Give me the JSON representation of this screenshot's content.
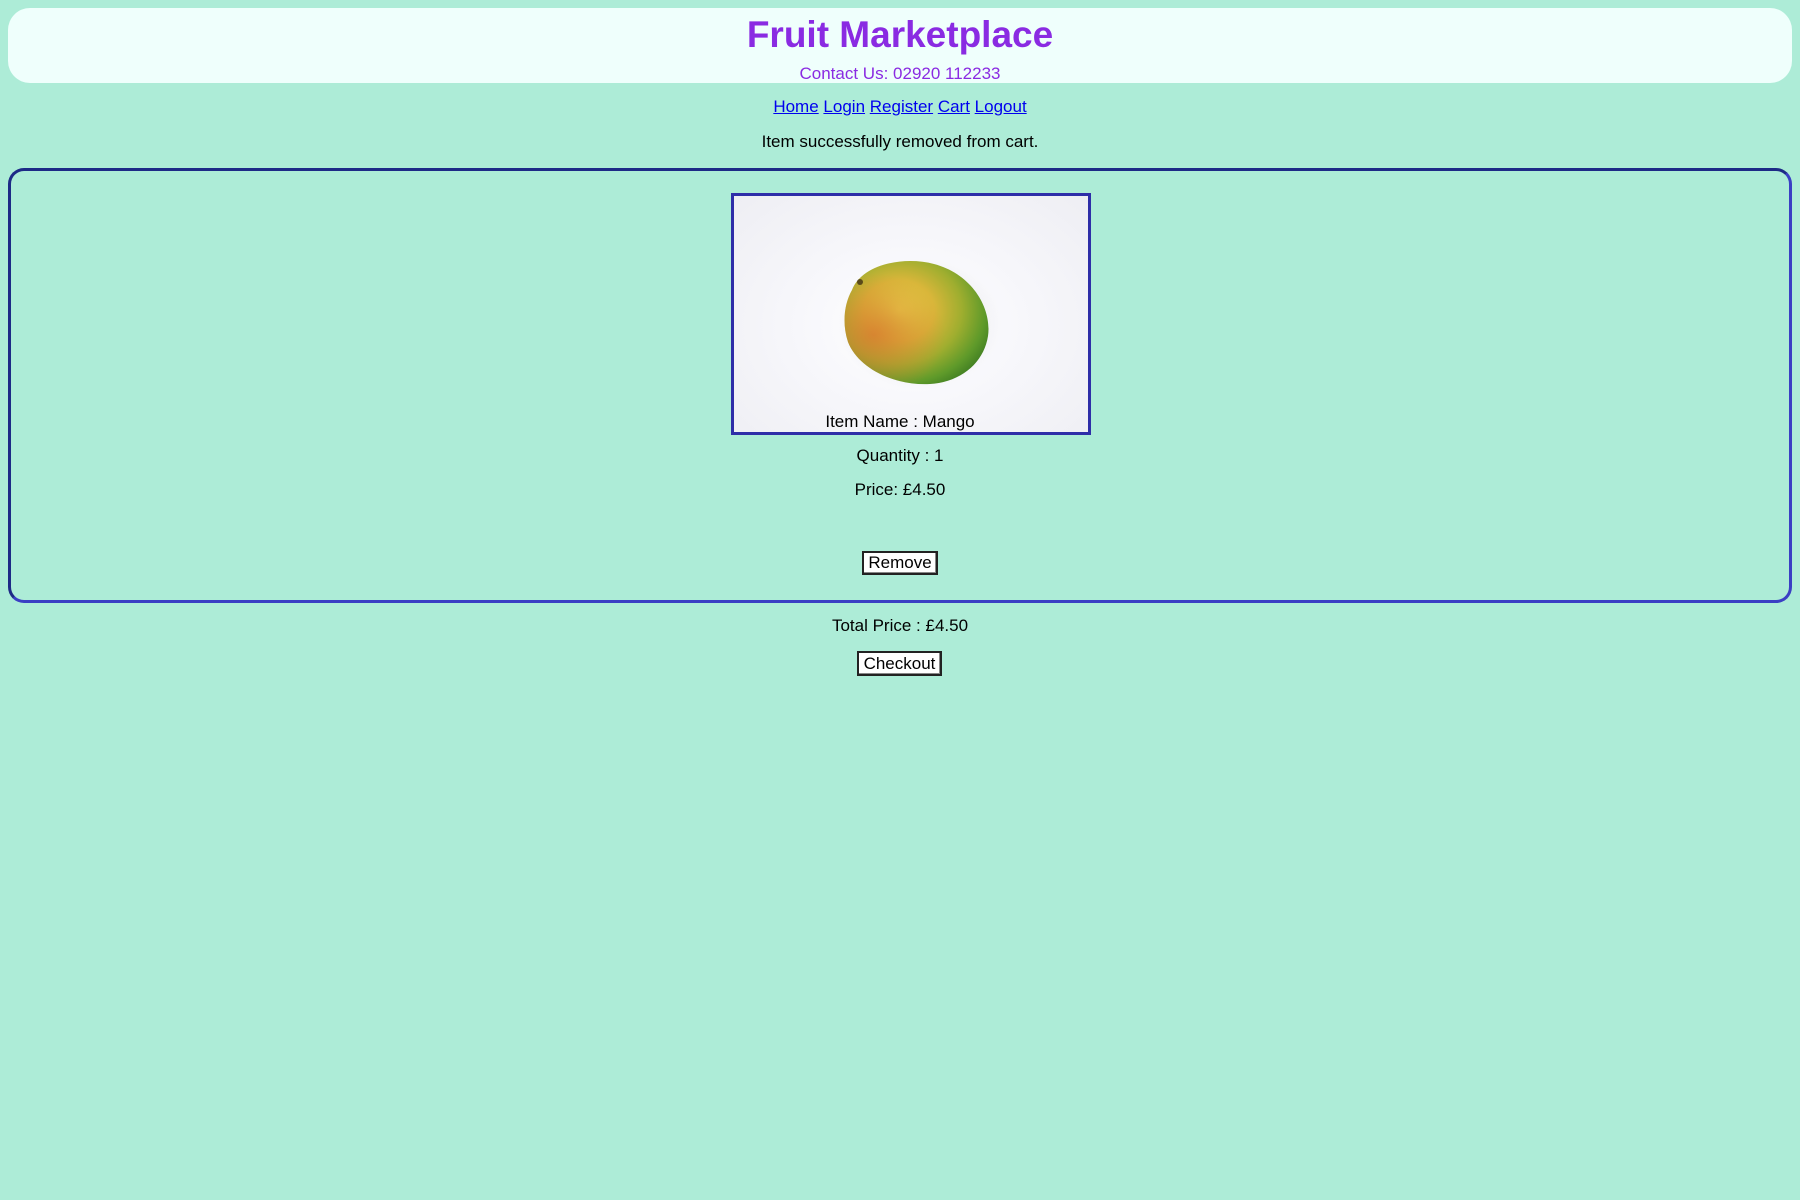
{
  "header": {
    "title": "Fruit Marketplace",
    "contact": "Contact Us: 02920 112233"
  },
  "nav": {
    "items": [
      "Home",
      "Login",
      "Register",
      "Cart",
      "Logout"
    ]
  },
  "status_message": "Item successfully removed from cart.",
  "cart": {
    "items": [
      {
        "image_icon": "mango-image",
        "name_line": "Item Name : Mango",
        "quantity_line": "Quantity : 1",
        "price_line": "Price: £4.50",
        "remove_label": "Remove"
      }
    ],
    "total_line": "Total Price : £4.50",
    "checkout_label": "Checkout"
  },
  "colors": {
    "background": "#adecd7",
    "header_bg": "#effffc",
    "title": "#8a2be2",
    "link": "#0000ee",
    "box_border": "#2e2ea8"
  }
}
